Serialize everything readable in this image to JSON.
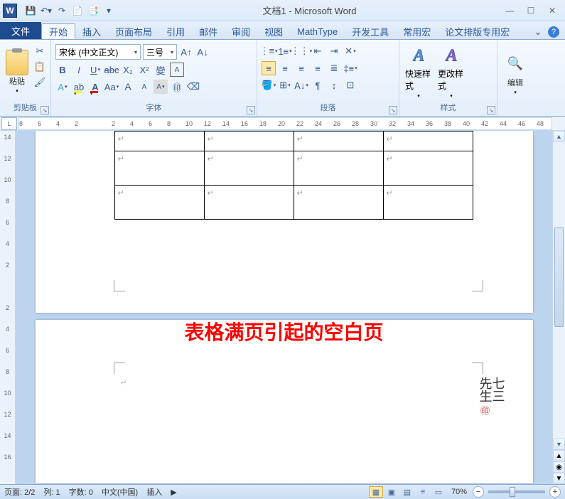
{
  "title": "文档1 - Microsoft Word",
  "qat": {
    "save": "💾",
    "undo": "↶",
    "redo": "↷"
  },
  "tabs": {
    "file": "文件",
    "items": [
      "开始",
      "插入",
      "页面布局",
      "引用",
      "邮件",
      "审阅",
      "视图",
      "MathType",
      "开发工具",
      "常用宏",
      "论文排版专用宏"
    ]
  },
  "ribbon": {
    "clipboard": {
      "label": "剪贴板",
      "paste": "粘贴"
    },
    "font": {
      "label": "字体",
      "name": "宋体 (中文正文)",
      "size": "三号"
    },
    "paragraph": {
      "label": "段落"
    },
    "styles": {
      "label": "样式",
      "quick": "快速样式",
      "change": "更改样式"
    },
    "editing": {
      "label": "编辑"
    }
  },
  "ruler": {
    "marks": [
      "8",
      "6",
      "4",
      "2",
      "",
      "2",
      "4",
      "6",
      "8",
      "10",
      "12",
      "14",
      "16",
      "18",
      "20",
      "22",
      "24",
      "26",
      "28",
      "30",
      "32",
      "34",
      "36",
      "38",
      "40",
      "42",
      "44",
      "46",
      "48"
    ]
  },
  "vruler": {
    "marks": [
      "14",
      "12",
      "10",
      "8",
      "6",
      "4",
      "2",
      "",
      "2",
      "4",
      "6",
      "8",
      "10",
      "12",
      "14",
      "16"
    ]
  },
  "annotation": "表格满页引起的空白页",
  "watermark": {
    "line1": "七三",
    "line2": "先生"
  },
  "status": {
    "page": "页面: 2/2",
    "col": "列: 1",
    "words": "字数: 0",
    "lang": "中文(中国)",
    "mode": "插入",
    "zoom": "70%"
  },
  "chart_data": null
}
